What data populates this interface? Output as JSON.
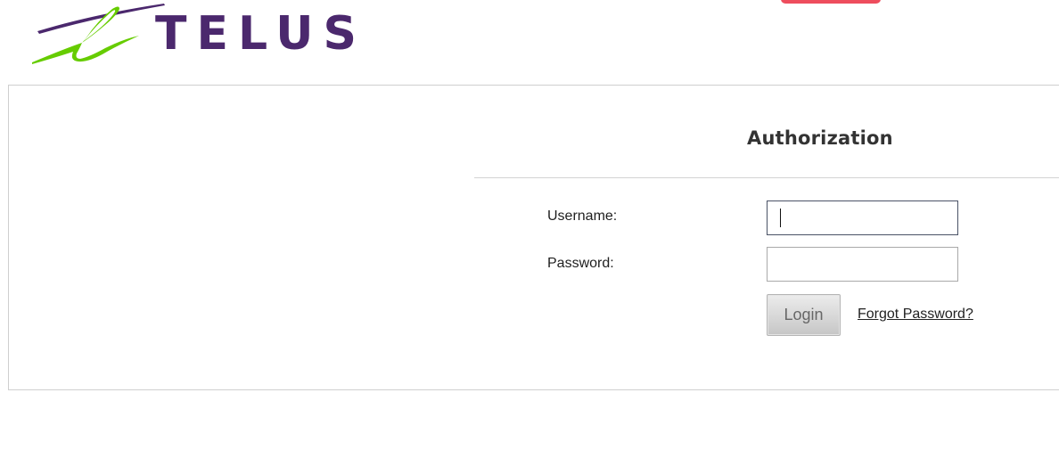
{
  "brand": {
    "logo_text": "TELUS",
    "purple": "#4b286d",
    "green": "#66cc00"
  },
  "top_banner": {
    "color": "#ee4d5d"
  },
  "auth": {
    "title": "Authorization",
    "username_label": "Username:",
    "username_value": "",
    "password_label": "Password:",
    "password_value": "",
    "login_label": "Login",
    "forgot_label": "Forgot Password?"
  }
}
